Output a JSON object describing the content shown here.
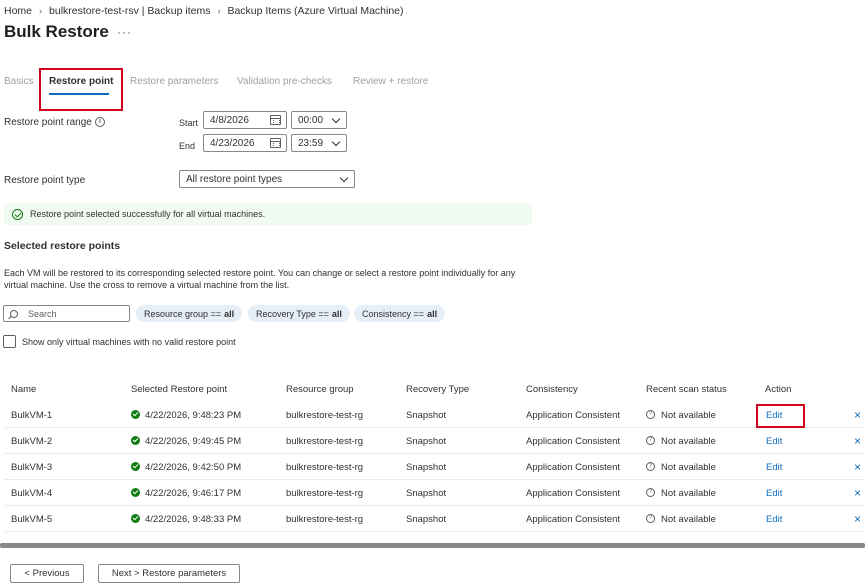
{
  "breadcrumb": {
    "items": [
      "Home",
      "bulkrestore-test-rsv | Backup items",
      "Backup Items (Azure Virtual Machine)"
    ],
    "separator": "›"
  },
  "page": {
    "title": "Bulk Restore",
    "more": "···"
  },
  "tabs": [
    {
      "label": "Basics",
      "active": false
    },
    {
      "label": "Restore point",
      "active": true
    },
    {
      "label": "Restore parameters",
      "active": false
    },
    {
      "label": "Validation pre-checks",
      "active": false
    },
    {
      "label": "Review + restore",
      "active": false
    }
  ],
  "form": {
    "range_label": "Restore point range",
    "start_label": "Start",
    "end_label": "End",
    "start_date": "4/8/2026",
    "start_time": "00:00",
    "end_date": "4/23/2026",
    "end_time": "23:59",
    "type_label": "Restore point type",
    "type_value": "All restore point types"
  },
  "banner": {
    "text": "Restore point selected successfully for all virtual machines."
  },
  "selected": {
    "title": "Selected restore points",
    "description": "Each VM will be restored to its corresponding selected restore point. You can change or select a restore point individually for any virtual machine. Use the cross to remove a virtual machine from the list."
  },
  "filters": {
    "search_placeholder": "Search",
    "pills": [
      {
        "key": "Resource group",
        "op": "==",
        "value": "all"
      },
      {
        "key": "Recovery Type",
        "op": "==",
        "value": "all"
      },
      {
        "key": "Consistency",
        "op": "==",
        "value": "all"
      }
    ],
    "checkbox_label": "Show only virtual machines with no valid restore point"
  },
  "table": {
    "columns": [
      "Name",
      "Selected Restore point",
      "Resource group",
      "Recovery Type",
      "Consistency",
      "Recent scan status",
      "Action"
    ],
    "rows": [
      {
        "name": "BulkVM-1",
        "restore_point": "4/22/2026, 9:48:23 PM",
        "resource_group": "bulkrestore-test-rg",
        "recovery_type": "Snapshot",
        "consistency": "Application Consistent",
        "scan_status": "Not available",
        "action": "Edit"
      },
      {
        "name": "BulkVM-2",
        "restore_point": "4/22/2026, 9:49:45 PM",
        "resource_group": "bulkrestore-test-rg",
        "recovery_type": "Snapshot",
        "consistency": "Application Consistent",
        "scan_status": "Not available",
        "action": "Edit"
      },
      {
        "name": "BulkVM-3",
        "restore_point": "4/22/2026, 9:42:50 PM",
        "resource_group": "bulkrestore-test-rg",
        "recovery_type": "Snapshot",
        "consistency": "Application Consistent",
        "scan_status": "Not available",
        "action": "Edit"
      },
      {
        "name": "BulkVM-4",
        "restore_point": "4/22/2026, 9:46:17 PM",
        "resource_group": "bulkrestore-test-rg",
        "recovery_type": "Snapshot",
        "consistency": "Application Consistent",
        "scan_status": "Not available",
        "action": "Edit"
      },
      {
        "name": "BulkVM-5",
        "restore_point": "4/22/2026, 9:48:33 PM",
        "resource_group": "bulkrestore-test-rg",
        "recovery_type": "Snapshot",
        "consistency": "Application Consistent",
        "scan_status": "Not available",
        "action": "Edit"
      }
    ],
    "remove_glyph": "×"
  },
  "footer": {
    "previous": "< Previous",
    "next": "Next > Restore parameters"
  },
  "colors": {
    "accent": "#0f6cbd",
    "success": "#107c10",
    "highlight": "#d0021b",
    "banner_bg": "#f1faf1"
  }
}
